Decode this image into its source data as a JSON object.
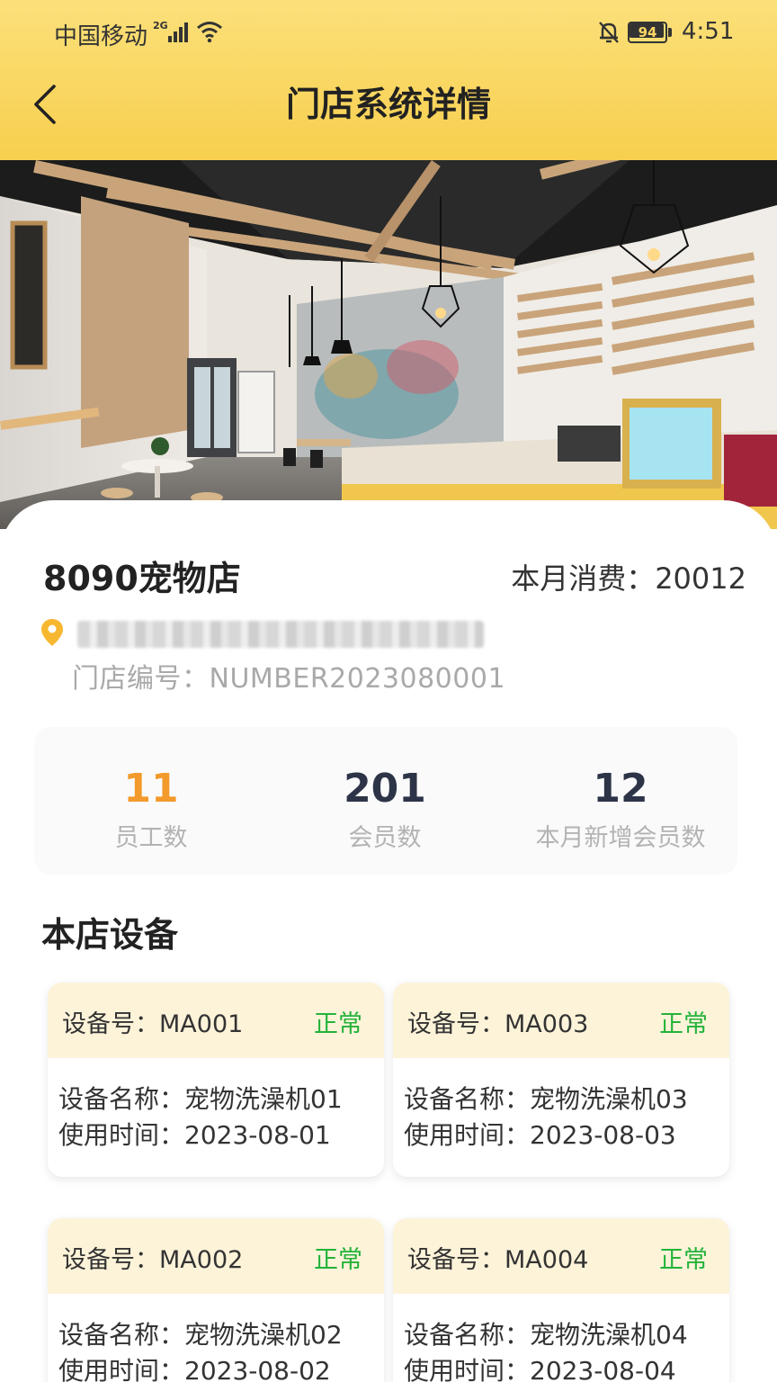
{
  "status_bar": {
    "carrier": "中国移动",
    "network": "2G",
    "battery": "94",
    "battery_level": 0.94,
    "time": "4:51"
  },
  "header": {
    "title": "门店系统详情"
  },
  "store": {
    "name": "8090宠物店",
    "monthly_spend": "本月消费：20012",
    "address": "",
    "store_number": "门店编号：NUMBER2023080001"
  },
  "stats": [
    {
      "value": "11",
      "label": "员工数"
    },
    {
      "value": "201",
      "label": "会员数"
    },
    {
      "value": "12",
      "label": "本月新增会员数"
    }
  ],
  "devices_section": {
    "title": "本店设备",
    "devices": [
      {
        "no": "设备号：MA001",
        "status": "正常",
        "name": "设备名称：宠物洗澡机01",
        "time": "使用时间：2023-08-01"
      },
      {
        "no": "设备号：MA003",
        "status": "正常",
        "name": "设备名称：宠物洗澡机03",
        "time": "使用时间：2023-08-03"
      },
      {
        "no": "设备号：MA002",
        "status": "正常",
        "name": "设备名称：宠物洗澡机02",
        "time": "使用时间：2023-08-02"
      },
      {
        "no": "设备号：MA004",
        "status": "正常",
        "name": "设备名称：宠物洗澡机04",
        "time": "使用时间：2023-08-04"
      }
    ]
  },
  "colors": {
    "header_yellow": "#f8cf4e",
    "accent_orange": "#f39a2c",
    "status_green": "#23b33a",
    "card_head": "#fdf3d9"
  }
}
